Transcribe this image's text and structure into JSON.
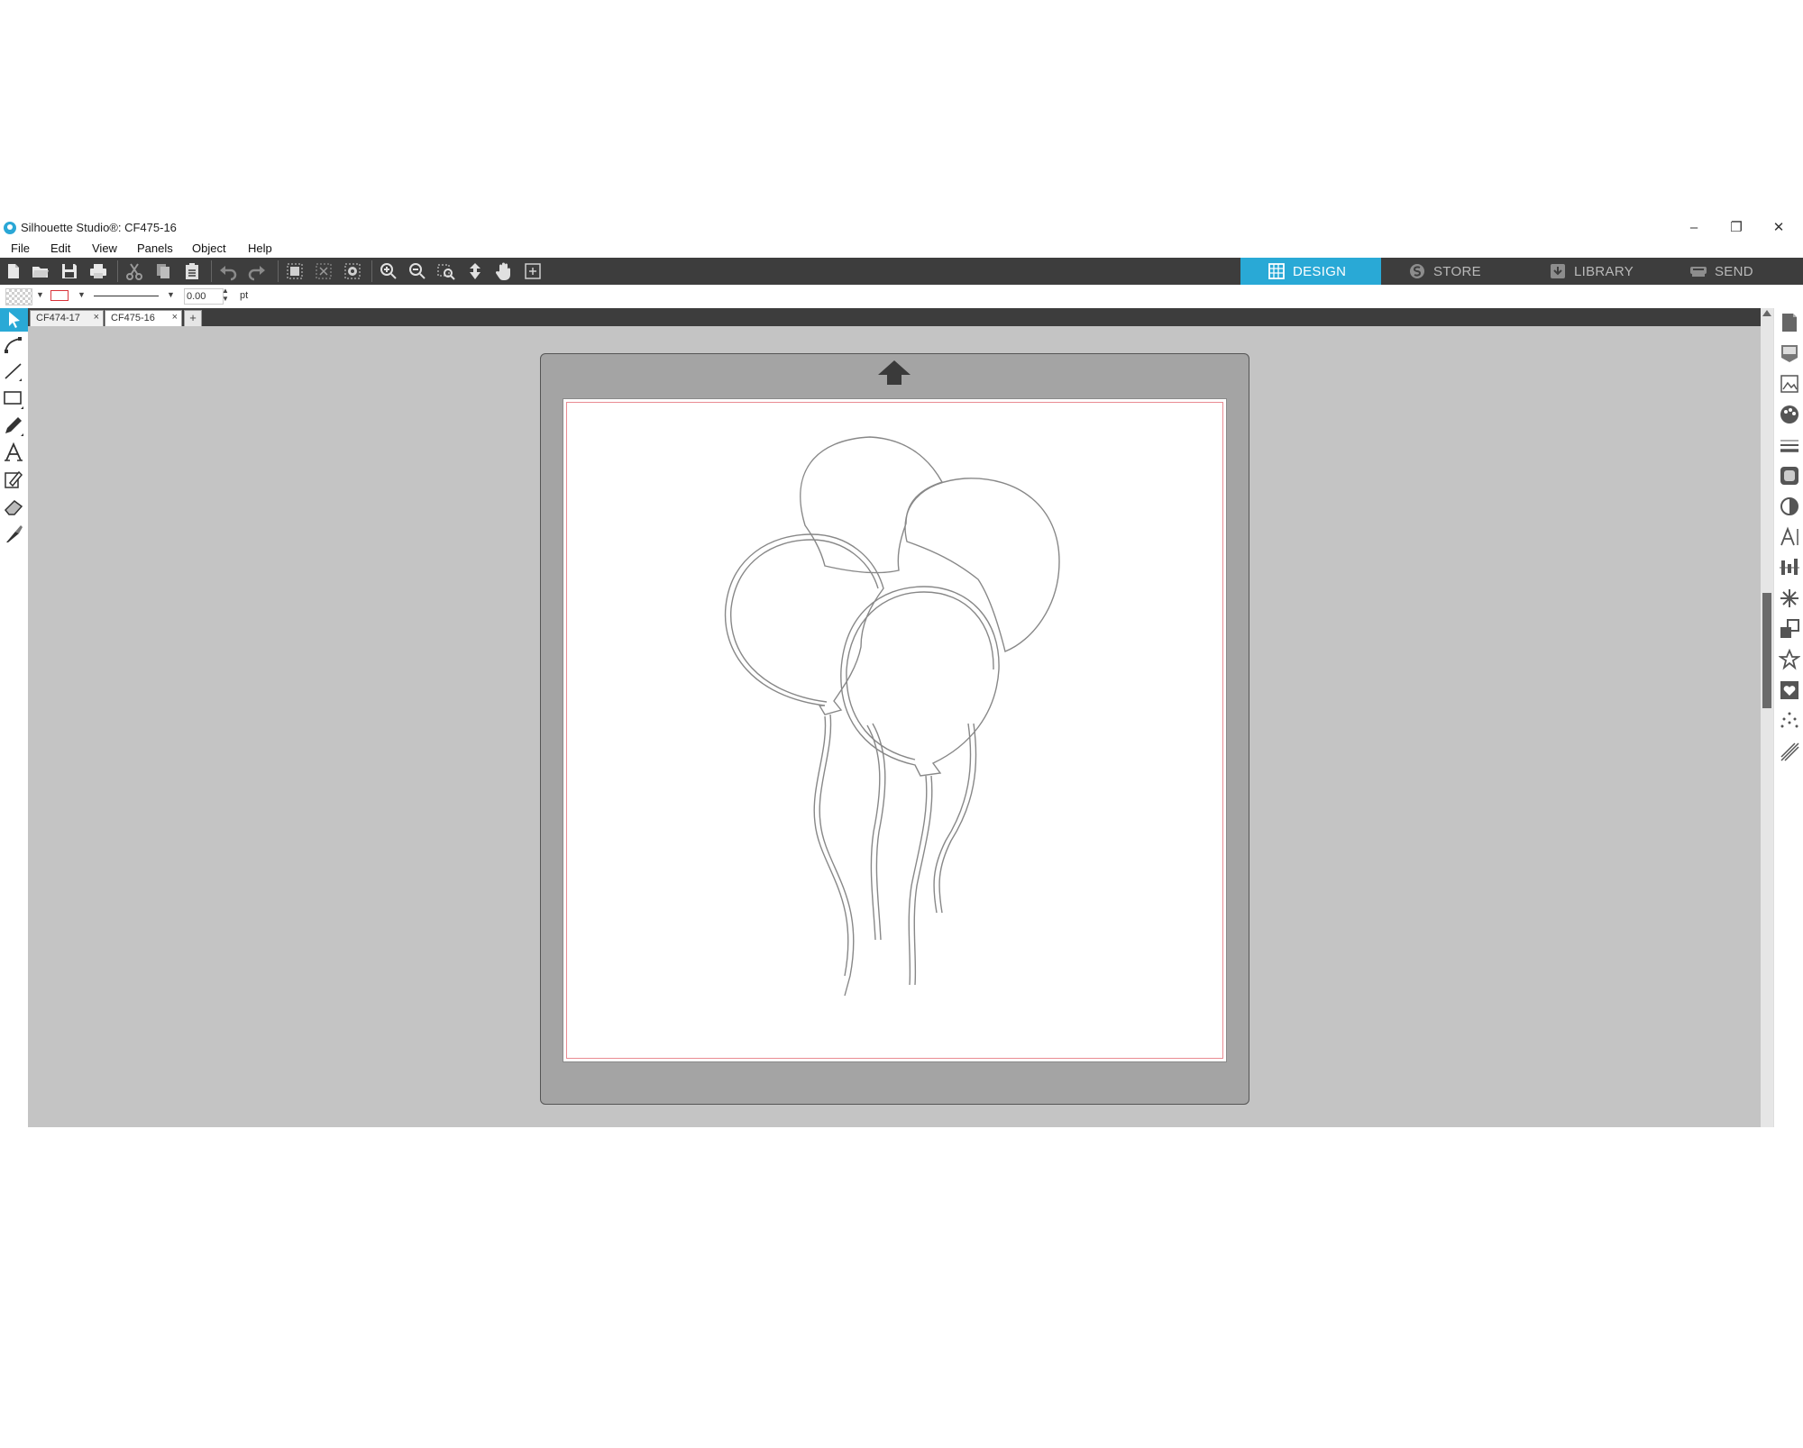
{
  "window": {
    "title": "Silhouette Studio®: CF475-16",
    "controls": [
      "–",
      "❐",
      "✕"
    ]
  },
  "menu": [
    "File",
    "Edit",
    "View",
    "Panels",
    "Object",
    "Help"
  ],
  "toolbar": {
    "icons": [
      "new-document-icon",
      "open-folder-icon",
      "save-icon",
      "print-icon",
      "cut-icon",
      "copy-icon",
      "paste-icon",
      "undo-icon",
      "redo-icon",
      "group-icon",
      "ungroup-icon",
      "compound-path-icon",
      "zoom-in-icon",
      "zoom-out-icon",
      "zoom-selection-icon",
      "fit-to-page-icon",
      "pan-hand-icon",
      "fit-window-icon"
    ],
    "modes": [
      {
        "label": "DESIGN",
        "active": true
      },
      {
        "label": "STORE",
        "active": false
      },
      {
        "label": "LIBRARY",
        "active": false
      },
      {
        "label": "SEND",
        "active": false
      }
    ],
    "accent_color": "#29a9d6"
  },
  "properties": {
    "line_width": "0.00",
    "unit": "pt",
    "line_color": "#d9343a"
  },
  "tabs": [
    {
      "label": "CF474-17",
      "close": "×"
    },
    {
      "label": "CF475-16",
      "close": "×"
    }
  ],
  "new_tab_label": "+",
  "left_tools": [
    "select-icon",
    "edit-points-icon",
    "line-tool-icon",
    "rectangle-tool-icon",
    "pencil-tool-icon",
    "text-tool-icon",
    "fill-tool-icon",
    "eraser-tool-icon",
    "knife-tool-icon"
  ],
  "right_panel": [
    "page-setup-icon",
    "registration-marks-icon",
    "image-trace-icon",
    "fill-color-icon",
    "line-style-icon",
    "pattern-fill-icon",
    "shadow-icon",
    "text-style-icon",
    "align-icon",
    "transform-icon",
    "offset-icon",
    "replicate-icon",
    "library-design-icon",
    "point-trace-icon",
    "sketch-icon"
  ],
  "canvas": {
    "design": "balloons-outline",
    "cut_border_color": "#e98b92"
  }
}
